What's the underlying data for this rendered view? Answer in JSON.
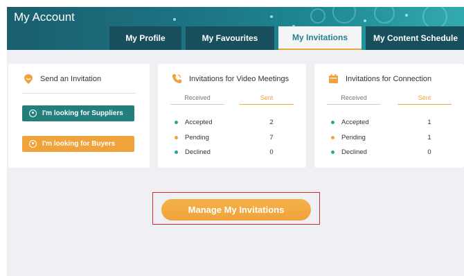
{
  "header": {
    "title": "My Account",
    "tabs": [
      {
        "label": "My Profile"
      },
      {
        "label": "My Favourites"
      },
      {
        "label": "My Invitations",
        "active": true
      },
      {
        "label": "My Content Schedule"
      }
    ]
  },
  "send_card": {
    "title": "Send an Invitation",
    "suppliers_button": "I'm looking for Suppliers",
    "buyers_button": "I'm looking for Buyers"
  },
  "video_card": {
    "title": "Invitations for Video Meetings",
    "tabs": {
      "received": "Received",
      "sent": "Sent",
      "active": "sent"
    },
    "rows": [
      {
        "label": "Accepted",
        "count": "2",
        "color": "#2aa5a0"
      },
      {
        "label": "Pending",
        "count": "7",
        "color": "#f0a23b"
      },
      {
        "label": "Declined",
        "count": "0",
        "color": "#2aa5a0"
      }
    ]
  },
  "connection_card": {
    "title": "Invitations for Connection",
    "tabs": {
      "received": "Received",
      "sent": "Sent",
      "active": "sent"
    },
    "rows": [
      {
        "label": "Accepted",
        "count": "1",
        "color": "#2aa5a0"
      },
      {
        "label": "Pending",
        "count": "1",
        "color": "#f0a23b"
      },
      {
        "label": "Declined",
        "count": "0",
        "color": "#2aa5a0"
      }
    ]
  },
  "manage_button": "Manage My Invitations",
  "colors": {
    "accent": "#f0a23b",
    "teal": "#237f7c",
    "highlight": "#d32f2f"
  }
}
